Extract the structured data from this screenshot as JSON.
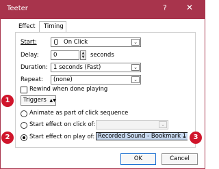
{
  "window": {
    "title": "Teeter",
    "help_label": "?",
    "close_label": "✕"
  },
  "tabs": [
    {
      "label": "Effect",
      "selected": false
    },
    {
      "label": "Timing",
      "selected": true
    }
  ],
  "timing": {
    "start_label": "Start:",
    "start_value": "On Click",
    "delay_label": "Delay:",
    "delay_value": "0",
    "delay_unit": "seconds",
    "duration_label": "Duration:",
    "duration_value": "1 seconds (Fast)",
    "repeat_label": "Repeat:",
    "repeat_value": "(none)",
    "rewind_label": "Rewind when done playing",
    "rewind_checked": false
  },
  "triggers": {
    "button_label": "Triggers",
    "option1_label": "Animate as part of click sequence",
    "option2_label": "Start effect on click of:",
    "option2_value": "",
    "option3_label": "Start effect on play of:",
    "option3_value": "Recorded Sound - Bookmark 1",
    "selected_option": 3
  },
  "badges": [
    "1",
    "2",
    "3"
  ],
  "buttons": {
    "ok_label": "OK",
    "cancel_label": "Cancel"
  },
  "colors": {
    "titlebar": "#a8344c",
    "badge": "#d0152b",
    "ok_border": "#1b6fd1",
    "selection": "#c7d8ef"
  },
  "icons": {
    "start_icon": "mouse-pointer-icon",
    "dropdown": "chevron-down-icon",
    "spinner": "spin-arrows-icon"
  }
}
